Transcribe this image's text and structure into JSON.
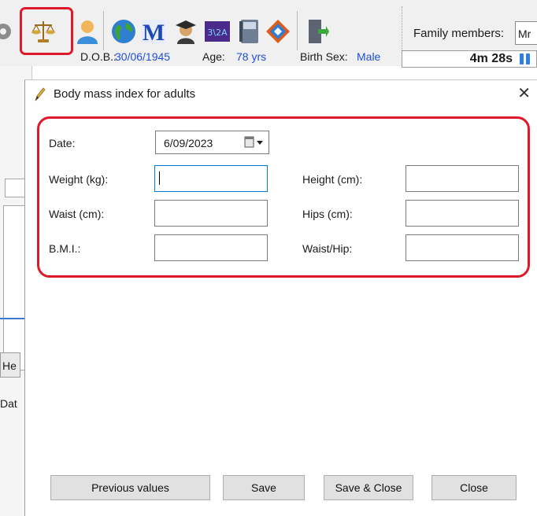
{
  "toolbar": {
    "icons": [
      "tools-icon",
      "scales-icon",
      "person-icon",
      "globe-icon",
      "medicines-icon",
      "graduate-icon",
      "scheme-icon",
      "book-icon",
      "diamond-icon",
      "exit-door-icon"
    ],
    "family_members_label": "Family members:",
    "family_members_value": "Mr"
  },
  "patient": {
    "dob_label": "D.O.B.:",
    "dob_value": "30/06/1945",
    "age_label": "Age:",
    "age_value": "78 yrs",
    "sex_label": "Birth Sex:",
    "sex_value": "Male"
  },
  "timer": {
    "value": "4m  28s"
  },
  "background": {
    "he_label": "He",
    "dat_label": "Dat"
  },
  "dialog": {
    "title": "Body mass index for adults",
    "close_glyph": "✕",
    "date_label": "Date:",
    "date_value": "6/09/2023",
    "weight_label": "Weight (kg):",
    "weight_value": "",
    "height_label": "Height (cm):",
    "height_value": "",
    "waist_label": "Waist (cm):",
    "waist_value": "",
    "hips_label": "Hips (cm):",
    "hips_value": "",
    "bmi_label": "B.M.I.:",
    "bmi_value": "",
    "waist_hip_label": "Waist/Hip:",
    "waist_hip_value": "",
    "buttons": {
      "previous": "Previous values",
      "save": "Save",
      "save_close": "Save & Close",
      "close": "Close"
    }
  },
  "colors": {
    "accent_blue": "#1f4ed8",
    "highlight_red": "#e0182b",
    "focus_blue": "#0078d7"
  }
}
